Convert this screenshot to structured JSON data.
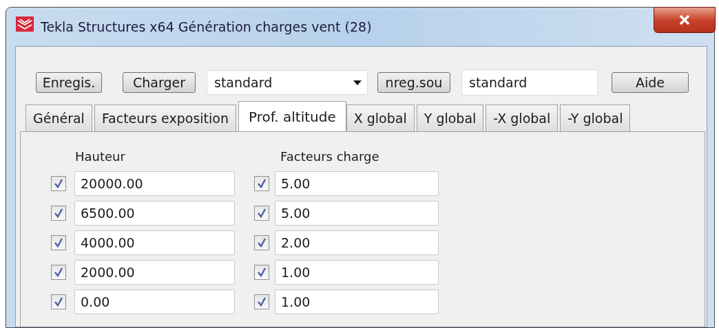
{
  "window": {
    "title": "Tekla Structures x64  Génération charges vent (28)"
  },
  "toolbar": {
    "save_button": "Enregis.",
    "load_button": "Charger",
    "preset_dropdown": {
      "value": "standard"
    },
    "save_as_button": "nreg.sou",
    "save_as_name": {
      "value": "standard"
    },
    "help_button": "Aide"
  },
  "tabs": [
    {
      "label": "Général",
      "selected": false
    },
    {
      "label": "Facteurs exposition",
      "selected": false
    },
    {
      "label": "Prof. altitude",
      "selected": true
    },
    {
      "label": "X global",
      "selected": false
    },
    {
      "label": "Y global",
      "selected": false
    },
    {
      "label": "-X global",
      "selected": false
    },
    {
      "label": "-Y global",
      "selected": false
    }
  ],
  "columns": [
    "Hauteur",
    "Facteurs charge"
  ],
  "rows": [
    {
      "height": {
        "checked": true,
        "value": "20000.00"
      },
      "load_factor": {
        "checked": true,
        "value": "5.00"
      }
    },
    {
      "height": {
        "checked": true,
        "value": "6500.00"
      },
      "load_factor": {
        "checked": true,
        "value": "5.00"
      }
    },
    {
      "height": {
        "checked": true,
        "value": "4000.00"
      },
      "load_factor": {
        "checked": true,
        "value": "2.00"
      }
    },
    {
      "height": {
        "checked": true,
        "value": "2000.00"
      },
      "load_factor": {
        "checked": true,
        "value": "1.00"
      }
    },
    {
      "height": {
        "checked": true,
        "value": "0.00"
      },
      "load_factor": {
        "checked": true,
        "value": "1.00"
      }
    }
  ]
}
